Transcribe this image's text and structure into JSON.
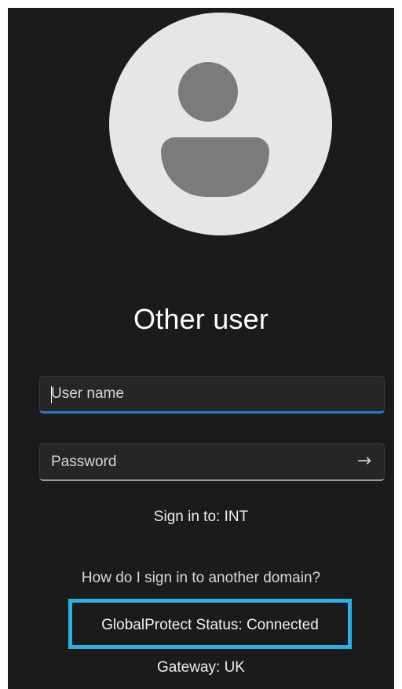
{
  "login": {
    "title": "Other user",
    "username": {
      "placeholder": "User name",
      "value": ""
    },
    "password": {
      "placeholder": "Password",
      "value": "",
      "submit_icon": "arrow-right-icon",
      "submit_glyph": "→"
    },
    "sign_in_to": "Sign in to: INT",
    "other_domain_link": "How do I sign in to another domain?",
    "globalprotect_status": "GlobalProtect Status: Connected",
    "gateway": "Gateway: UK"
  },
  "colors": {
    "background": "#1b1b1b",
    "avatar_circle": "#e6e6e6",
    "avatar_figure": "#7b7b7b",
    "focus_underline": "#2f78c5",
    "highlight_box": "#2bb2e4"
  }
}
